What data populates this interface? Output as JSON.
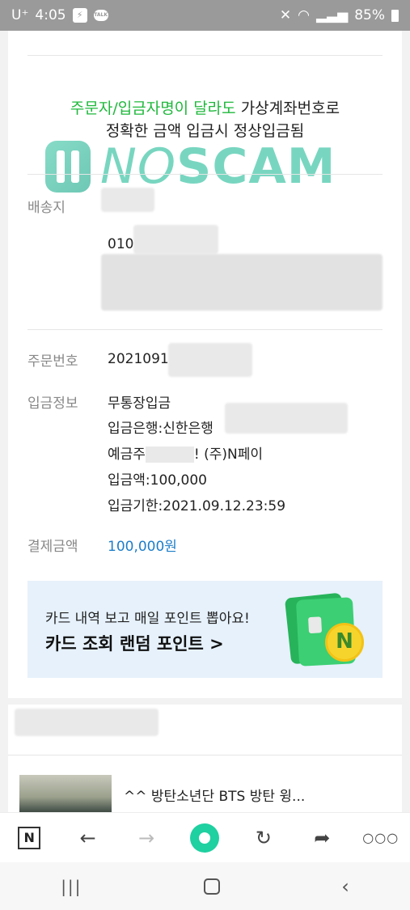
{
  "status_bar": {
    "carrier": "U⁺",
    "time": "4:05",
    "battery": "85%"
  },
  "notice": {
    "green_text": "주문자/입금자명이 달라도",
    "rest_text": " 가상계좌번호로",
    "line2": "정확한 금액 입금시 정상입금됨"
  },
  "watermark": {
    "no": "NO",
    "scam": "SCAM"
  },
  "shipping": {
    "label": "배송지",
    "phone_prefix": "010"
  },
  "order": {
    "label": "주문번호",
    "number": "2021091"
  },
  "deposit": {
    "label": "입금정보",
    "method": "무통장입금",
    "bank": "입금은행:신한은행",
    "holder_prefix": "예금주",
    "holder_suffix": "! (주)N페이",
    "amount": "입금액:100,000",
    "deadline": "입금기한:2021.09.12.23:59"
  },
  "payment": {
    "label": "결제금액",
    "amount": "100,000원"
  },
  "banner": {
    "line1": "카드 내역 보고 매일 포인트 뽑아요!",
    "line2": "카드 조회 랜덤 포인트 >",
    "coin_letter": "N"
  },
  "news": {
    "title": "^^ 방탄소년단 BTS 방탄 윙..."
  },
  "toolbar": {
    "home_icon_letter": "N"
  }
}
